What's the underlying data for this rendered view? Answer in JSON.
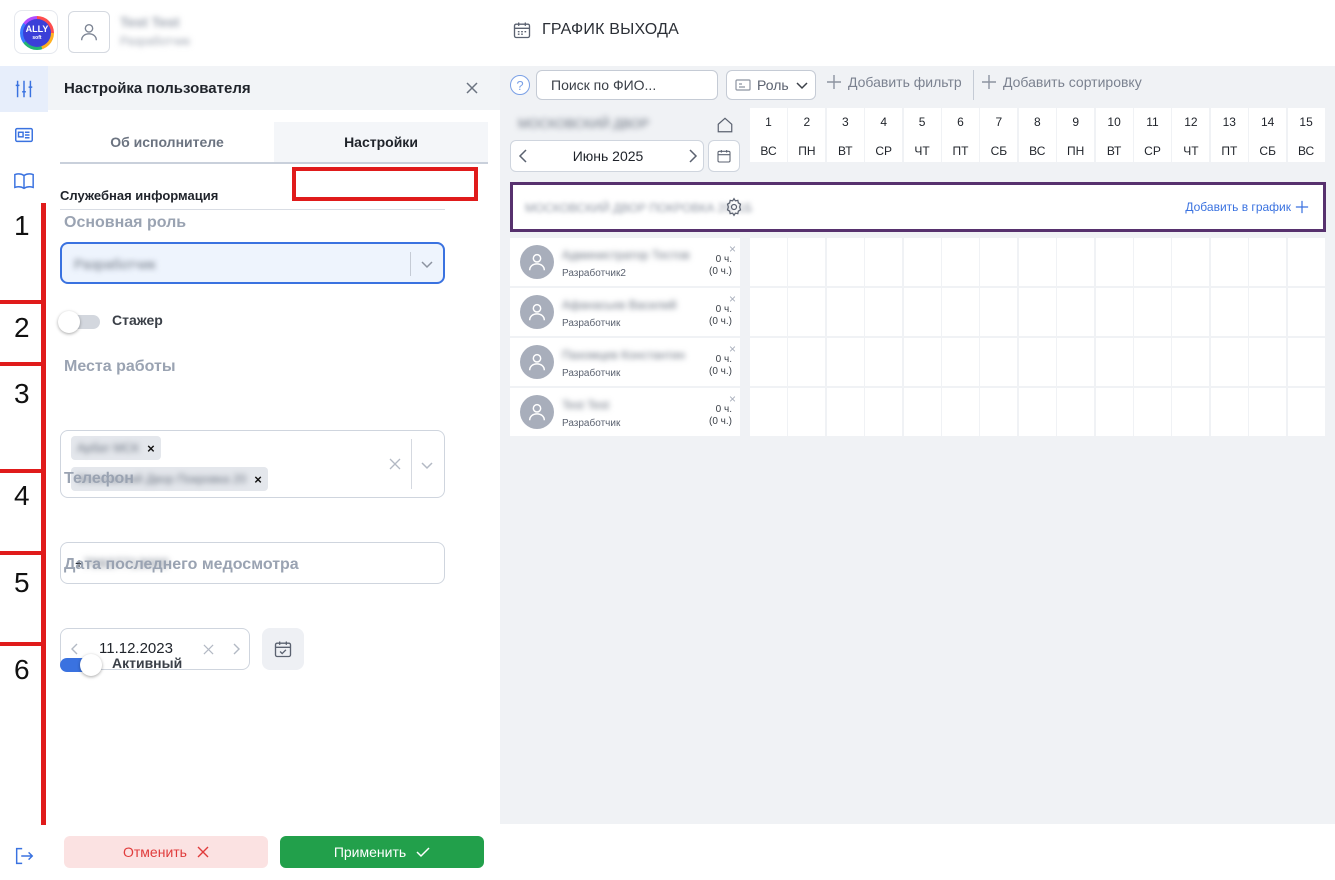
{
  "header": {
    "logo_text": "ALLY",
    "logo_sub": "soft",
    "user_name": "Test Test",
    "user_role": "Разработчик",
    "page_title": "ГРАФИК ВЫХОДА"
  },
  "panel": {
    "title": "Настройка пользователя",
    "tabs": [
      {
        "label": "Об исполнителе"
      },
      {
        "label": "Настройки"
      }
    ],
    "section_title": "Служебная информация",
    "main_role": {
      "label": "Основная роль",
      "value": "Разработчик"
    },
    "trainee": {
      "label": "Стажер",
      "on": false
    },
    "workplaces": {
      "label": "Места работы",
      "chips": [
        "Арбат МСК",
        "Московский Двор Покровка 20"
      ]
    },
    "phone": {
      "label": "Телефон",
      "prefix": "+",
      "value": "79937713000"
    },
    "medcheck": {
      "label": "Дата последнего медосмотра",
      "value": "11.12.2023"
    },
    "active": {
      "label": "Активный",
      "on": true
    }
  },
  "markers": [
    "1",
    "2",
    "3",
    "4",
    "5",
    "6"
  ],
  "footer": {
    "cancel_label": "Отменить",
    "apply_label": "Применить"
  },
  "schedule": {
    "search_placeholder": "Поиск по ФИО...",
    "role_filter": "Роль",
    "add_filter": "Добавить фильтр",
    "add_sort": "Добавить сортировку",
    "location": "МОСКОВСКИЙ ДВОР",
    "month": "Июнь 2025",
    "days": [
      {
        "n": "1",
        "w": "ВС"
      },
      {
        "n": "2",
        "w": "ПН"
      },
      {
        "n": "3",
        "w": "ВТ"
      },
      {
        "n": "4",
        "w": "СР"
      },
      {
        "n": "5",
        "w": "ЧТ"
      },
      {
        "n": "6",
        "w": "ПТ"
      },
      {
        "n": "7",
        "w": "СБ"
      },
      {
        "n": "8",
        "w": "ВС"
      },
      {
        "n": "9",
        "w": "ПН"
      },
      {
        "n": "10",
        "w": "ВТ"
      },
      {
        "n": "11",
        "w": "СР"
      },
      {
        "n": "12",
        "w": "ЧТ"
      },
      {
        "n": "13",
        "w": "ПТ"
      },
      {
        "n": "14",
        "w": "СБ"
      },
      {
        "n": "15",
        "w": "ВС"
      }
    ],
    "site_name": "МОСКОВСКИЙ ДВОР ПОКРОВКА 20, 1Б",
    "add_to_schedule": "Добавить в график",
    "employees": [
      {
        "name": "Администратор Тестов",
        "role": "Разработчик2",
        "hours": "0 ч.",
        "hours_total": "(0 ч.)"
      },
      {
        "name": "Афанасьев Василий",
        "role": "Разработчик",
        "hours": "0 ч.",
        "hours_total": "(0 ч.)"
      },
      {
        "name": "Пахомцев Константин",
        "role": "Разработчик",
        "hours": "0 ч.",
        "hours_total": "(0 ч.)"
      },
      {
        "name": "Test Test",
        "role": "Разработчик",
        "hours": "0 ч.",
        "hours_total": "(0 ч.)"
      }
    ]
  },
  "colors": {
    "accent": "#3a72e0",
    "apply": "#22a04b",
    "cancel_text": "#e03b3b",
    "marker": "#e01b1b",
    "site_border": "#57316e"
  }
}
